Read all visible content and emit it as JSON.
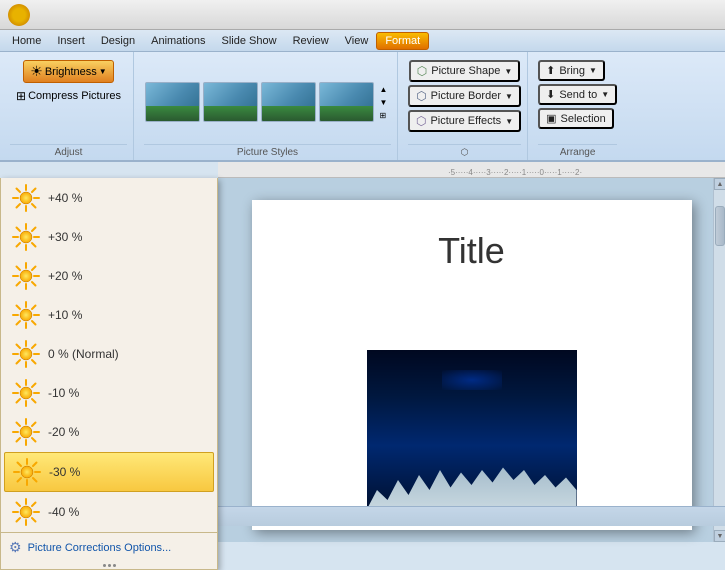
{
  "titlebar": {
    "logo_color": "#e8b200"
  },
  "menubar": {
    "items": [
      {
        "id": "home",
        "label": "Home"
      },
      {
        "id": "insert",
        "label": "Insert"
      },
      {
        "id": "design",
        "label": "Design"
      },
      {
        "id": "animations",
        "label": "Animations"
      },
      {
        "id": "slideshow",
        "label": "Slide Show"
      },
      {
        "id": "review",
        "label": "Review"
      },
      {
        "id": "view",
        "label": "View"
      },
      {
        "id": "format",
        "label": "Format",
        "active": true
      }
    ]
  },
  "ribbon": {
    "adjust_group": {
      "brightness_label": "Brightness",
      "compress_label": "Compress Pictures"
    },
    "styles_label": "Picture Styles",
    "right_panel": {
      "picture_shape": "Picture Shape",
      "picture_border": "Picture Border",
      "picture_effects": "Picture Effects"
    },
    "arrange_label": "Arrange",
    "bring_label": "Bring",
    "send_to_label": "Send to",
    "selection_label": "Selection"
  },
  "brightness_dropdown": {
    "items": [
      {
        "id": "p40",
        "label": "+40 %",
        "selected": false
      },
      {
        "id": "p30",
        "label": "+30 %",
        "selected": false
      },
      {
        "id": "p20",
        "label": "+20 %",
        "selected": false
      },
      {
        "id": "p10",
        "label": "+10 %",
        "selected": false
      },
      {
        "id": "p0",
        "label": "0 % (Normal)",
        "selected": false
      },
      {
        "id": "n10",
        "label": "-10 %",
        "selected": false
      },
      {
        "id": "n20",
        "label": "-20 %",
        "selected": false
      },
      {
        "id": "n30",
        "label": "-30 %",
        "selected": true
      },
      {
        "id": "n40",
        "label": "-40 %",
        "selected": false
      }
    ],
    "footer_label": "Picture Corrections Options..."
  },
  "slide": {
    "title": "Title"
  }
}
